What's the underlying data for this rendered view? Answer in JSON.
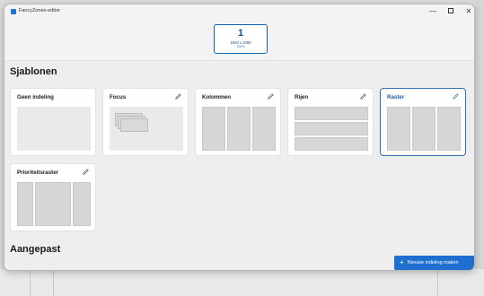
{
  "window": {
    "title": "FancyZones-editor",
    "min_glyph": "—",
    "close_glyph": "✕"
  },
  "monitor": {
    "number": "1",
    "resolution": "1920 x 1080",
    "scale": "100%"
  },
  "sections": {
    "templates_title": "Sjablonen",
    "custom_title": "Aangepast"
  },
  "layouts": [
    {
      "name": "Geen indeling",
      "editable": false,
      "selected": false,
      "preview": "blank"
    },
    {
      "name": "Focus",
      "editable": true,
      "selected": false,
      "preview": "focus"
    },
    {
      "name": "Kolommen",
      "editable": true,
      "selected": false,
      "preview": "columns"
    },
    {
      "name": "Rijen",
      "editable": true,
      "selected": false,
      "preview": "rows"
    },
    {
      "name": "Raster",
      "editable": true,
      "selected": true,
      "preview": "grid"
    },
    {
      "name": "Prioriteitsraster",
      "editable": true,
      "selected": false,
      "preview": "priority-grid"
    }
  ],
  "actions": {
    "new_layout_label": "Nieuwe indeling maken",
    "plus_glyph": "+"
  },
  "colors": {
    "accent": "#1e6fd0",
    "selected_border": "#2f6fb5",
    "zone": "#d6d6d6"
  }
}
